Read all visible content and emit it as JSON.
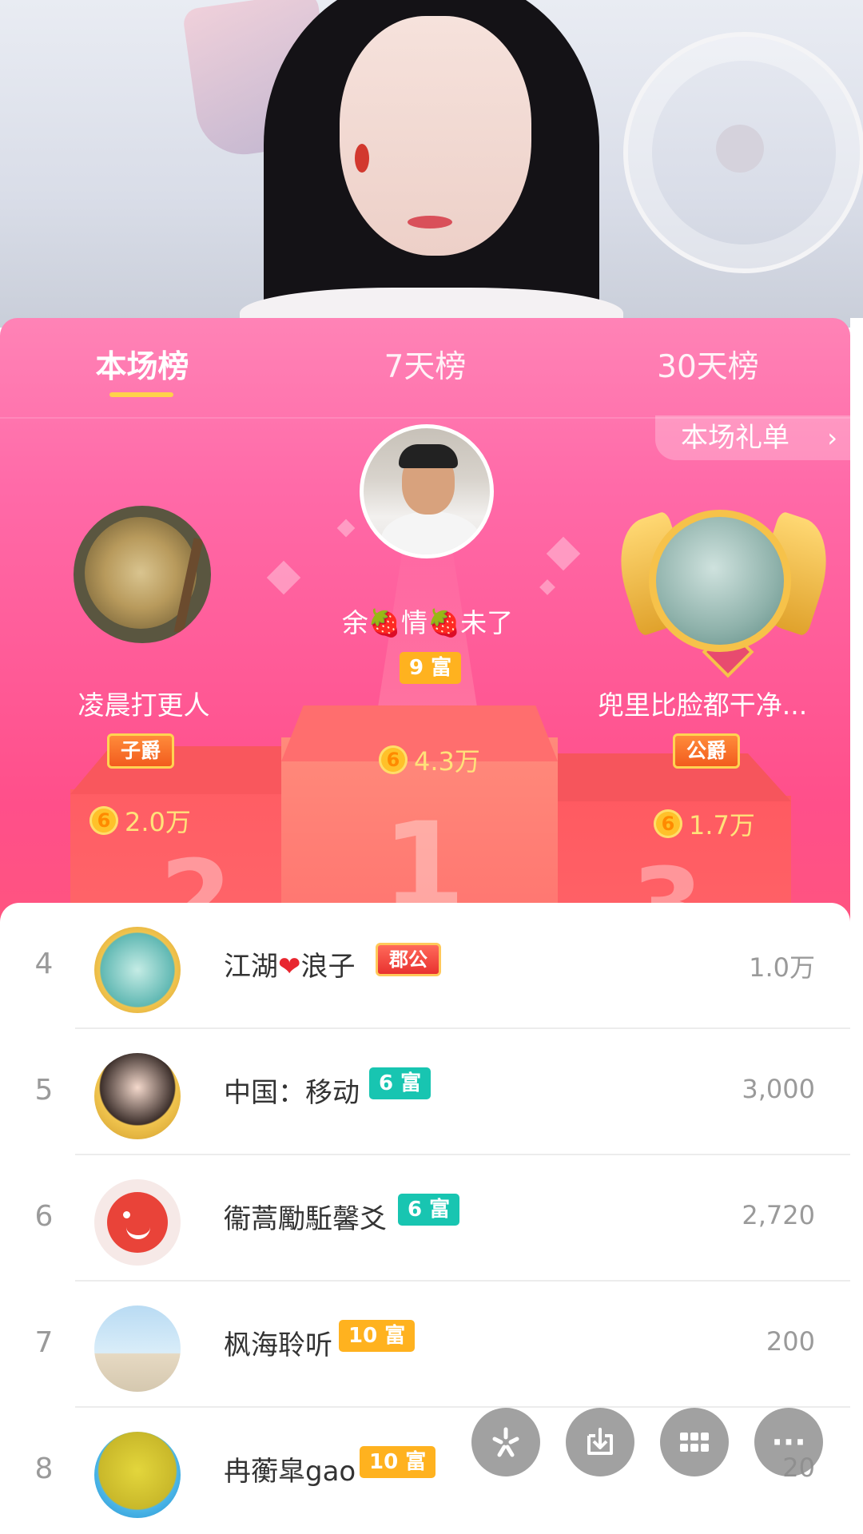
{
  "tabs": [
    {
      "label": "本场榜",
      "active": true
    },
    {
      "label": "7天榜",
      "active": false
    },
    {
      "label": "30天榜",
      "active": false
    }
  ],
  "gift_list_button": {
    "label": "本场礼单",
    "chevron": "›"
  },
  "podium": [
    {
      "rank": 1,
      "name": "余🍓情🍓未了",
      "badge": "9 富",
      "badge_type": "rich",
      "coins": "4.3万",
      "avatar_icon": "user-photo-icon"
    },
    {
      "rank": 2,
      "name": "凌晨打更人",
      "badge": "子爵",
      "badge_type": "title",
      "coins": "2.0万",
      "avatar_icon": "gong-photo-icon"
    },
    {
      "rank": 3,
      "name": "兜里比脸都干净...",
      "badge": "公爵",
      "badge_type": "title",
      "coins": "1.7万",
      "avatar_icon": "waterfall-photo-icon"
    }
  ],
  "podium_numbers": [
    "1",
    "2",
    "3"
  ],
  "coin_symbol": "6",
  "list": [
    {
      "rank": "4",
      "name_before": "江湖",
      "name_after": "浪子",
      "heart": "❤",
      "badge": "郡公",
      "badge_type": "title",
      "amount": "1.0万"
    },
    {
      "rank": "5",
      "name": "中国：移动",
      "badge": "6 富",
      "badge_type": "rich-teal",
      "amount": "3,000"
    },
    {
      "rank": "6",
      "name": "衞蒿勵駈馨爻",
      "badge": "6 富",
      "badge_type": "rich-teal",
      "amount": "2,720"
    },
    {
      "rank": "7",
      "name": "枫海聆听",
      "badge": "10 富",
      "badge_type": "rich-yellow",
      "amount": "200"
    },
    {
      "rank": "8",
      "name": "冉蘅皐gao",
      "badge": "10 富",
      "badge_type": "rich-yellow",
      "amount": "20"
    }
  ],
  "floating_actions": [
    {
      "icon": "sparkle-icon"
    },
    {
      "icon": "download-icon"
    },
    {
      "icon": "grid-icon"
    },
    {
      "icon": "more-icon",
      "label": "···"
    }
  ],
  "colors": {
    "panel_top": "#ff83b6",
    "panel_mid": "#ff4f8a",
    "tab_indicator": "#ffd24a",
    "coin_text": "#ffe27a",
    "rich_yellow": "#ffb21f",
    "rich_teal": "#18c5b1"
  }
}
